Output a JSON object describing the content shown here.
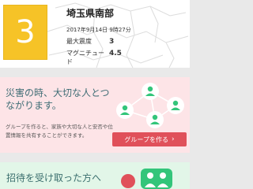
{
  "quake": {
    "intensity": "3",
    "region": "埼玉県南部",
    "time": "2017年9月14日 9時27分",
    "max_intensity_label": "最大震度",
    "max_intensity_value": "3",
    "magnitude_label": "マグニチュード",
    "magnitude_value": "4.5",
    "colors": {
      "intensity_bg": "#f6c327"
    }
  },
  "promo": {
    "title": "災害の時、大切な人とつながります。",
    "description": "グループを作ると、家族や大切な人と安否や位置情報を共有することができます。",
    "button_label": "グループを作る",
    "button_icon": "chevron-right-icon",
    "colors": {
      "bg": "#fde4e7",
      "button": "#e0505a",
      "accent": "#33c57a"
    }
  },
  "invite": {
    "title": "招待を受け取った方へ",
    "icon": "group-people-icon",
    "colors": {
      "bg": "#e2f6e8",
      "accent": "#33c57a"
    }
  }
}
